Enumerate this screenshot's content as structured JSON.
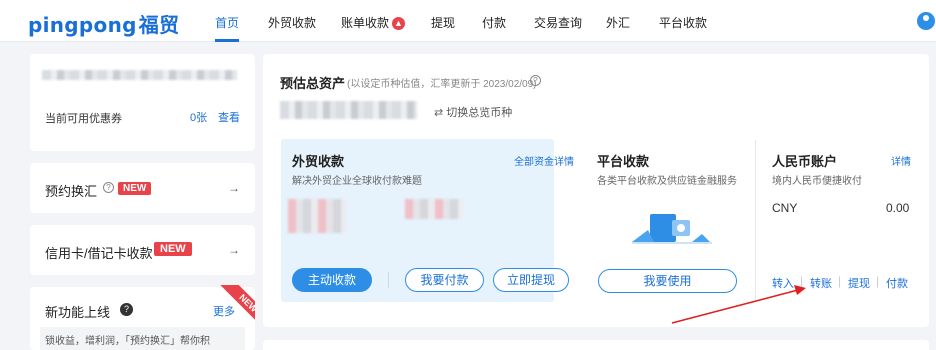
{
  "brand": {
    "logo_latin": "pingpong",
    "logo_cn": "福贸"
  },
  "nav": {
    "items": [
      "首页",
      "外贸收款",
      "账单收款",
      "提现",
      "付款",
      "交易查询",
      "外汇",
      "平台收款"
    ],
    "active_index": 0
  },
  "sidebar": {
    "coupon_label": "当前可用优惠券",
    "coupon_count": "0张",
    "coupon_view": "查看",
    "reserve_fx": "预约换汇",
    "reserve_fx_badge": "NEW",
    "card_collect": "信用卡/借记卡收款",
    "card_collect_badge": "NEW",
    "new_features": "新功能上线",
    "new_features_more": "更多",
    "new_features_ribbon": "NEW",
    "feature_desc_line1": "锁收益，增利润，「预约换汇」帮你积",
    "chevron": "→"
  },
  "assets": {
    "title": "预估总资产",
    "note": "(以设定币种估值，汇率更新于 2023/02/09)",
    "switch_label": "切换总览币种"
  },
  "foreign_trade": {
    "title": "外贸收款",
    "desc": "解决外贸企业全球收付款难题",
    "detail_link": "全部资金详情",
    "btn_collect": "主动收款",
    "btn_pay": "我要付款",
    "btn_withdraw": "立即提现"
  },
  "platform": {
    "title": "平台收款",
    "desc": "各类平台收款及供应链金融服务",
    "btn_use": "我要使用"
  },
  "rmb": {
    "title": "人民币账户",
    "detail_link": "详情",
    "desc": "境内人民币便捷收付",
    "currency": "CNY",
    "amount": "0.00",
    "actions": [
      "转入",
      "转账",
      "提现",
      "付款"
    ]
  },
  "colors": {
    "accent": "#1a6fd6",
    "button": "#2e8ee6",
    "badge": "#e8424b",
    "annotation_arrow": "#e02020"
  },
  "icons": [
    "user-avatar-icon",
    "fire-icon",
    "question-circle-icon",
    "switch-arrows-icon",
    "chevron-right-icon",
    "wallet-illustration-icon"
  ]
}
